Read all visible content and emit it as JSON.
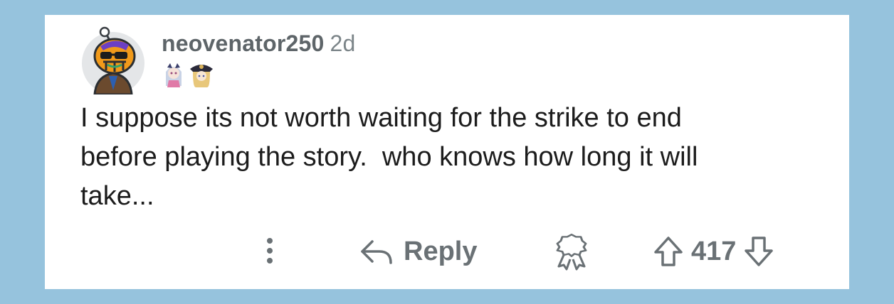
{
  "comment": {
    "author": "neovenator250",
    "age": "2d",
    "body": "I suppose its not worth waiting for the strike to end\nbefore playing the story.  who knows how long it will\ntake...",
    "avatar_icon": "snoo-avatar-icon",
    "flair_icons": [
      "flair-character-1-icon",
      "flair-character-2-icon"
    ]
  },
  "actions": {
    "more_icon": "more-vertical-icon",
    "reply_label": "Reply",
    "reply_icon": "reply-arrow-icon",
    "award_icon": "award-icon",
    "upvote_icon": "upvote-arrow-icon",
    "downvote_icon": "downvote-arrow-icon",
    "score": "417"
  },
  "colors": {
    "background": "#96c3dd",
    "card": "#ffffff",
    "muted_text": "#6a7175",
    "body_text": "#1c1c1c"
  }
}
